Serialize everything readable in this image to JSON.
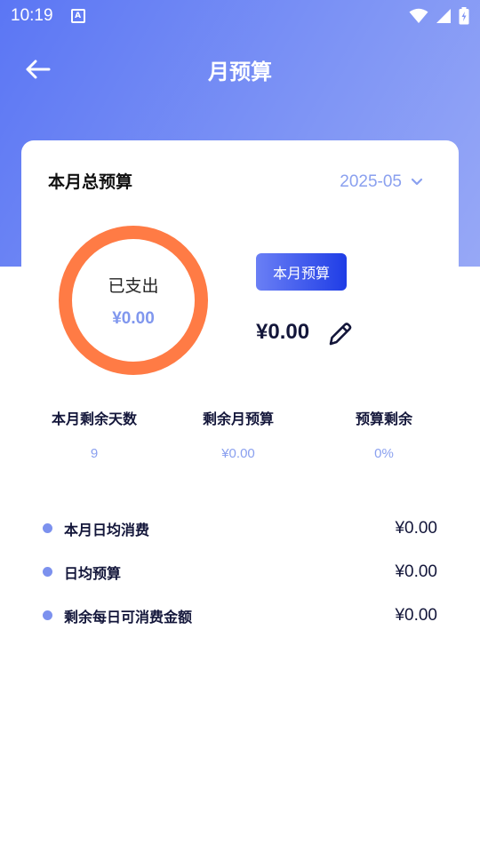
{
  "status_bar": {
    "time": "10:19",
    "icons": [
      "app-notification-icon",
      "wifi-icon",
      "signal-icon",
      "battery-icon"
    ]
  },
  "header": {
    "title": "月预算",
    "back_icon": "arrow-left-icon"
  },
  "colors": {
    "header_gradient_start": "#5b76f4",
    "header_gradient_end": "#97a8f6",
    "ring": "#ff7b45",
    "accent": "#8aa0ef",
    "chip_gradient_start": "#6a7ff5",
    "chip_gradient_end": "#1f3de6",
    "dark_text": "#13163a"
  },
  "summary": {
    "title": "本月总预算",
    "month": "2025-05",
    "spent_label": "已支出",
    "spent_value": "¥0.00",
    "budget_chip": "本月预算",
    "budget_amount": "¥0.00"
  },
  "stats": [
    {
      "label": "本月剩余天数",
      "value": "9"
    },
    {
      "label": "剩余月预算",
      "value": "¥0.00"
    },
    {
      "label": "预算剩余",
      "value": "0%"
    }
  ],
  "details": [
    {
      "label": "本月日均消费",
      "value": "¥0.00"
    },
    {
      "label": "日均预算",
      "value": "¥0.00"
    },
    {
      "label": "剩余每日可消费金额",
      "value": "¥0.00"
    }
  ]
}
